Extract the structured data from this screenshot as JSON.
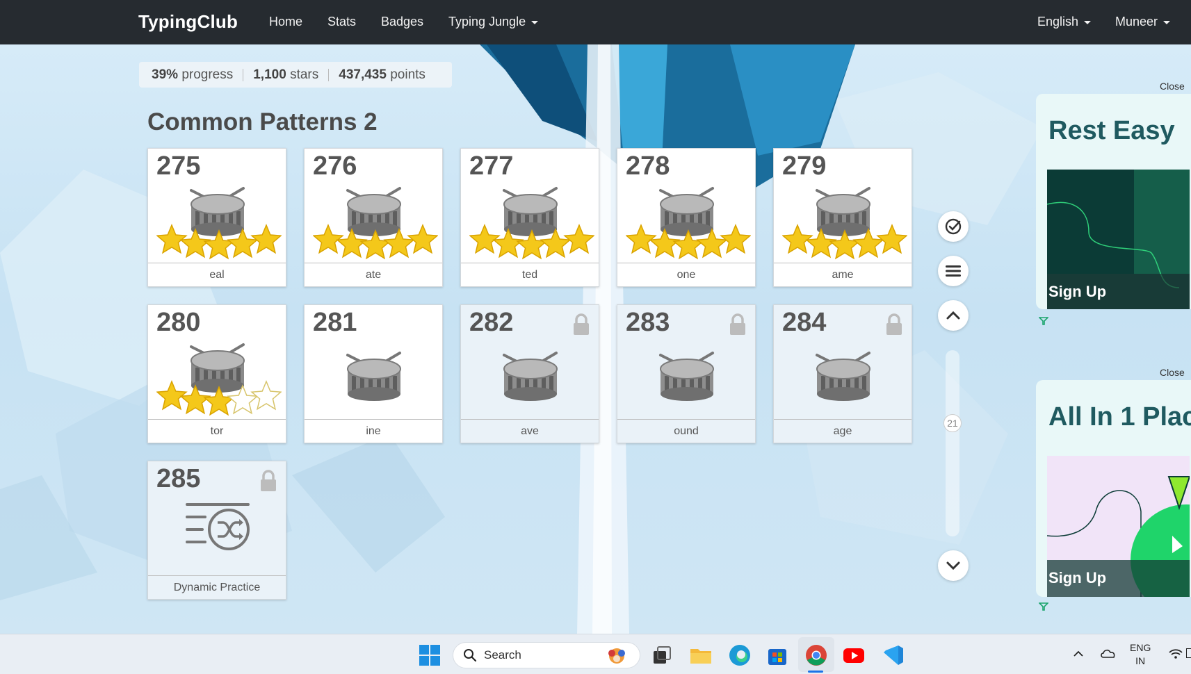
{
  "navbar": {
    "brand": "TypingClub",
    "links": [
      "Home",
      "Stats",
      "Badges"
    ],
    "jungle": "Typing Jungle",
    "language": "English",
    "user": "Muneer"
  },
  "progress": {
    "percent": "39%",
    "percent_label": "progress",
    "stars": "1,100",
    "stars_label": "stars",
    "points": "437,435",
    "points_label": "points"
  },
  "section_title": "Common Patterns 2",
  "lessons": [
    {
      "num": "275",
      "label": "eal",
      "stars": 5,
      "locked": false
    },
    {
      "num": "276",
      "label": "ate",
      "stars": 5,
      "locked": false
    },
    {
      "num": "277",
      "label": "ted",
      "stars": 5,
      "locked": false
    },
    {
      "num": "278",
      "label": "one",
      "stars": 5,
      "locked": false
    },
    {
      "num": "279",
      "label": "ame",
      "stars": 5,
      "locked": false
    },
    {
      "num": "280",
      "label": "tor",
      "stars": 3,
      "locked": false
    },
    {
      "num": "281",
      "label": "ine",
      "stars": 0,
      "locked": false
    },
    {
      "num": "282",
      "label": "ave",
      "stars": 0,
      "locked": true
    },
    {
      "num": "283",
      "label": "ound",
      "stars": 0,
      "locked": true
    },
    {
      "num": "284",
      "label": "age",
      "stars": 0,
      "locked": true
    },
    {
      "num": "285",
      "label": "Dynamic Practice",
      "stars": 0,
      "locked": true,
      "type": "practice"
    }
  ],
  "scroll": {
    "current": "21"
  },
  "icons": [
    "check-circle-icon",
    "menu-icon",
    "chevron-up-icon",
    "chevron-down-icon",
    "lock-icon",
    "drum-icon",
    "star-icon",
    "shuffle-icon"
  ],
  "ads": [
    {
      "title": "Rest Easy",
      "cta": "Sign Up",
      "close": "Close"
    },
    {
      "title": "All In 1 Plac",
      "cta": "Sign Up",
      "close": "Close"
    }
  ],
  "taskbar": {
    "search": "Search",
    "lang_top": "ENG",
    "lang_bottom": "IN"
  },
  "colors": {
    "navbar": "#262b30",
    "star": "#f4c81a",
    "ad_dark": "#0b3b36",
    "ad_green": "#1fd46a"
  }
}
